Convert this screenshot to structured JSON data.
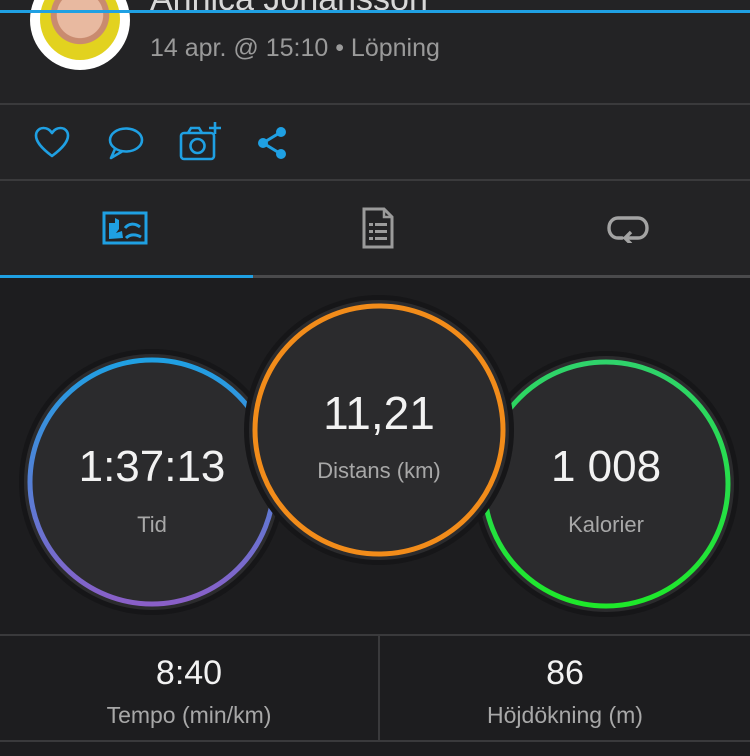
{
  "header": {
    "name": "Annica Johansson",
    "meta": "14 apr. @ 15:10 • Löpning"
  },
  "actions": {
    "icons": [
      "heart-icon",
      "comment-icon",
      "add-photo-icon",
      "share-icon"
    ]
  },
  "tabs": {
    "icons": [
      "chart-icon",
      "document-icon",
      "loop-icon"
    ],
    "active_index": 0
  },
  "stats": {
    "tid": {
      "value": "1:37:13",
      "label": "Tid"
    },
    "distans": {
      "value": "11,21",
      "label": "Distans (km)"
    },
    "kalorier": {
      "value": "1 008",
      "label": "Kalorier"
    }
  },
  "bottom": {
    "tempo": {
      "value": "8:40",
      "label": "Tempo (min/km)"
    },
    "hojd": {
      "value": "86",
      "label": "Höjdökning (m)"
    }
  },
  "colors": {
    "accent": "#1fa0e3",
    "tid_ring": [
      "#1fa0e3",
      "#8a5fc8"
    ],
    "distans_ring": "#f28c1a",
    "kalorier_ring": [
      "#2fd36b",
      "#1ee82a"
    ]
  }
}
